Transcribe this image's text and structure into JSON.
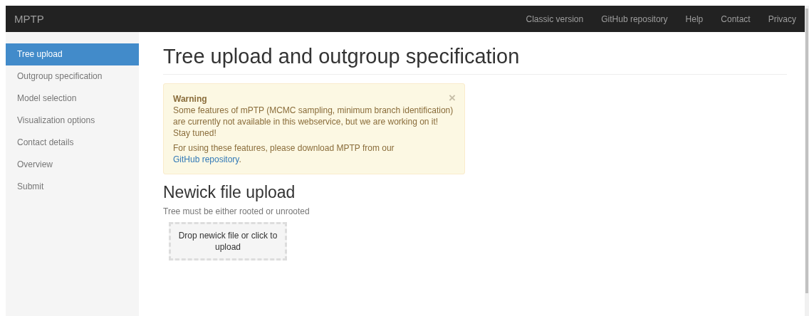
{
  "navbar": {
    "brand": "MPTP",
    "links": [
      {
        "label": "Classic version"
      },
      {
        "label": "GitHub repository"
      },
      {
        "label": "Help"
      },
      {
        "label": "Contact"
      },
      {
        "label": "Privacy"
      }
    ]
  },
  "sidebar": {
    "items": [
      {
        "label": "Tree upload",
        "selected": true
      },
      {
        "label": "Outgroup specification",
        "selected": false
      },
      {
        "label": "Model selection",
        "selected": false
      },
      {
        "label": "Visualization options",
        "selected": false
      },
      {
        "label": "Contact details",
        "selected": false
      },
      {
        "label": "Overview",
        "selected": false
      },
      {
        "label": "Submit",
        "selected": false
      }
    ]
  },
  "main": {
    "title": "Tree upload and outgroup specification",
    "alert": {
      "title": "Warning",
      "close": "×",
      "message": "Some features of mPTP (MCMC sampling, minimum branch identification) are currently not available in this webservice, but we are working on it! Stay tuned!",
      "note": "For using these features, please download MPTP from our ",
      "link": "GitHub repository",
      "note_end": "."
    },
    "section_title": "Newick file upload",
    "hint": "Tree must be either rooted or unrooted",
    "dropzone": "Drop newick file or click to upload"
  }
}
